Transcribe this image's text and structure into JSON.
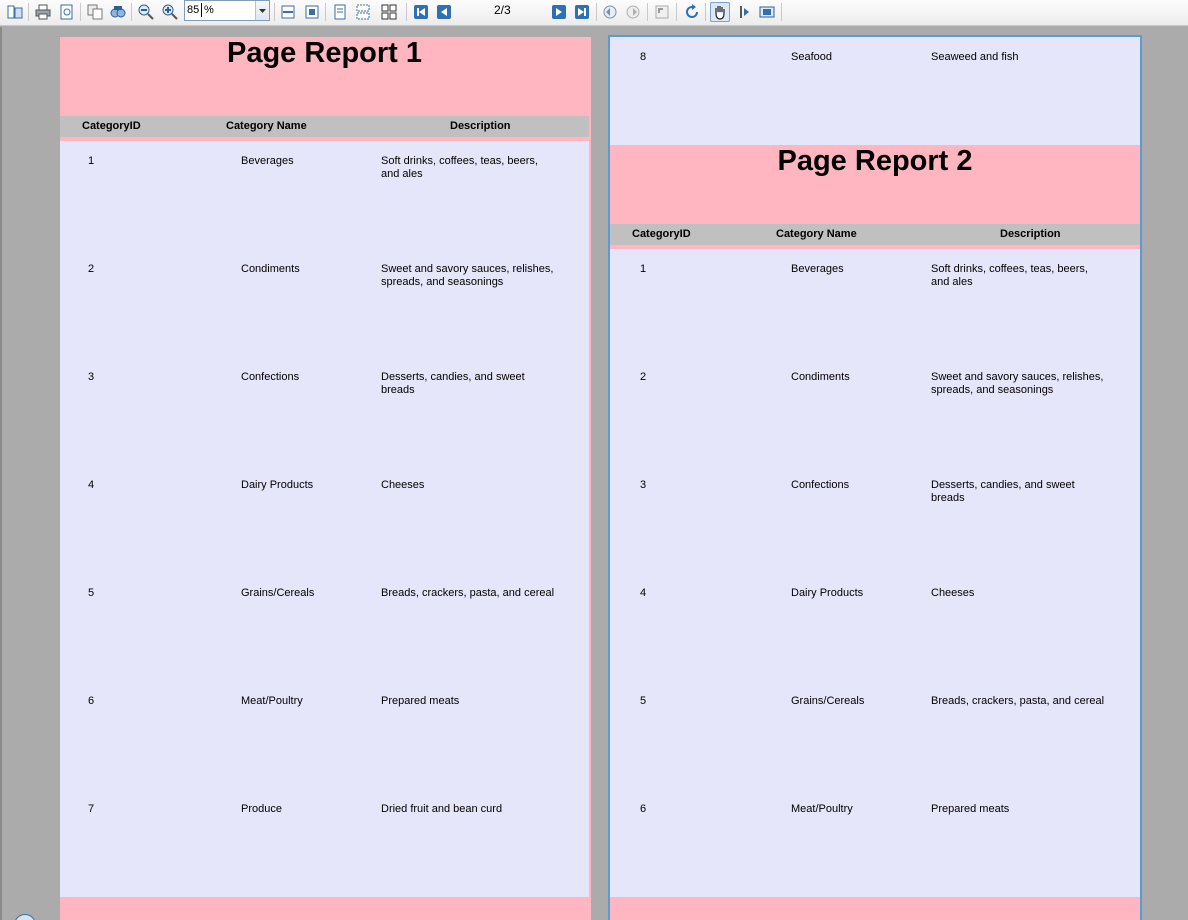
{
  "toolbar": {
    "zoom_value": "85",
    "zoom_unit": "%",
    "page_indicator": "2/3",
    "icons": [
      "document-map-icon",
      "print-icon",
      "page-setup-icon",
      "copy-icon",
      "find-icon",
      "zoom-out-icon",
      "zoom-in-icon",
      "fit-width-icon",
      "fit-page-icon",
      "single-page-icon",
      "continuous-icon",
      "multipage-icon",
      "first-page-icon",
      "previous-page-icon",
      "next-page-icon",
      "last-page-icon",
      "back-icon",
      "forward-icon",
      "undo-icon",
      "refresh-icon",
      "pan-hand-icon",
      "select-text-icon",
      "snapshot-icon"
    ]
  },
  "page1": {
    "title": "Page Report 1",
    "headers": {
      "id": "CategoryID",
      "name": "Category Name",
      "desc": "Description"
    },
    "rows": [
      {
        "id": "1",
        "name": "Beverages",
        "desc": "Soft drinks, coffees, teas, beers, and ales"
      },
      {
        "id": "2",
        "name": "Condiments",
        "desc": "Sweet and savory sauces, relishes, spreads, and seasonings"
      },
      {
        "id": "3",
        "name": "Confections",
        "desc": "Desserts, candies, and sweet breads"
      },
      {
        "id": "4",
        "name": "Dairy Products",
        "desc": "Cheeses"
      },
      {
        "id": "5",
        "name": "Grains/Cereals",
        "desc": "Breads, crackers, pasta, and cereal"
      },
      {
        "id": "6",
        "name": "Meat/Poultry",
        "desc": "Prepared meats"
      },
      {
        "id": "7",
        "name": "Produce",
        "desc": "Dried fruit and bean curd"
      }
    ]
  },
  "page2": {
    "top_row": {
      "id": "8",
      "name": "Seafood",
      "desc": "Seaweed and fish"
    },
    "title": "Page Report 2",
    "headers": {
      "id": "CategoryID",
      "name": "Category Name",
      "desc": "Description"
    },
    "rows": [
      {
        "id": "1",
        "name": "Beverages",
        "desc": "Soft drinks, coffees, teas, beers, and ales"
      },
      {
        "id": "2",
        "name": "Condiments",
        "desc": "Sweet and savory sauces, relishes, spreads, and seasonings"
      },
      {
        "id": "3",
        "name": "Confections",
        "desc": "Desserts, candies, and sweet breads"
      },
      {
        "id": "4",
        "name": "Dairy Products",
        "desc": "Cheeses"
      },
      {
        "id": "5",
        "name": "Grains/Cereals",
        "desc": "Breads, crackers, pasta, and cereal"
      },
      {
        "id": "6",
        "name": "Meat/Poultry",
        "desc": "Prepared meats"
      }
    ]
  },
  "colors": {
    "header_pink": "#ffb6c1",
    "detail_lavender": "#e6e6fa",
    "column_header_gray": "#c0c0c0",
    "viewer_background": "#ababab",
    "selected_page_border": "#5b9bd5"
  }
}
